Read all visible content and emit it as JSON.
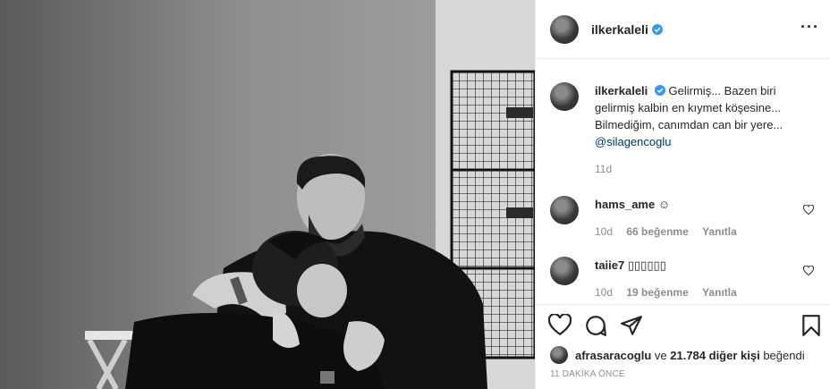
{
  "post": {
    "author": "ilkerkaleli",
    "more_icon": "more-options-icon",
    "caption": {
      "username": "ilkerkaleli",
      "text": "Gelirmiş... Bazen biri gelirmiş kalbin en kıymet köşesine... Bilmediğim, canımdan can bir yere...",
      "mention": "@silagencoglu",
      "age": "11d"
    },
    "comments": [
      {
        "username": "hams_ame",
        "text": "☺",
        "age": "10d",
        "likes": "66 beğenme",
        "reply": "Yanıtla"
      },
      {
        "username": "taiie7",
        "text": "▯▯▯▯▯▯",
        "age": "10d",
        "likes": "19 beğenme",
        "reply": "Yanıtla"
      }
    ],
    "likes": {
      "first_user": "afrasaracoglu",
      "joiner": "ve",
      "count_text": "21.784 diğer kişi",
      "verb": "beğendi"
    },
    "timestamp": "11 DAKİKA ÖNCE"
  },
  "colors": {
    "verified": "#3897f0",
    "text": "#262626",
    "muted": "#8e8e8e",
    "mention": "#00376b"
  }
}
